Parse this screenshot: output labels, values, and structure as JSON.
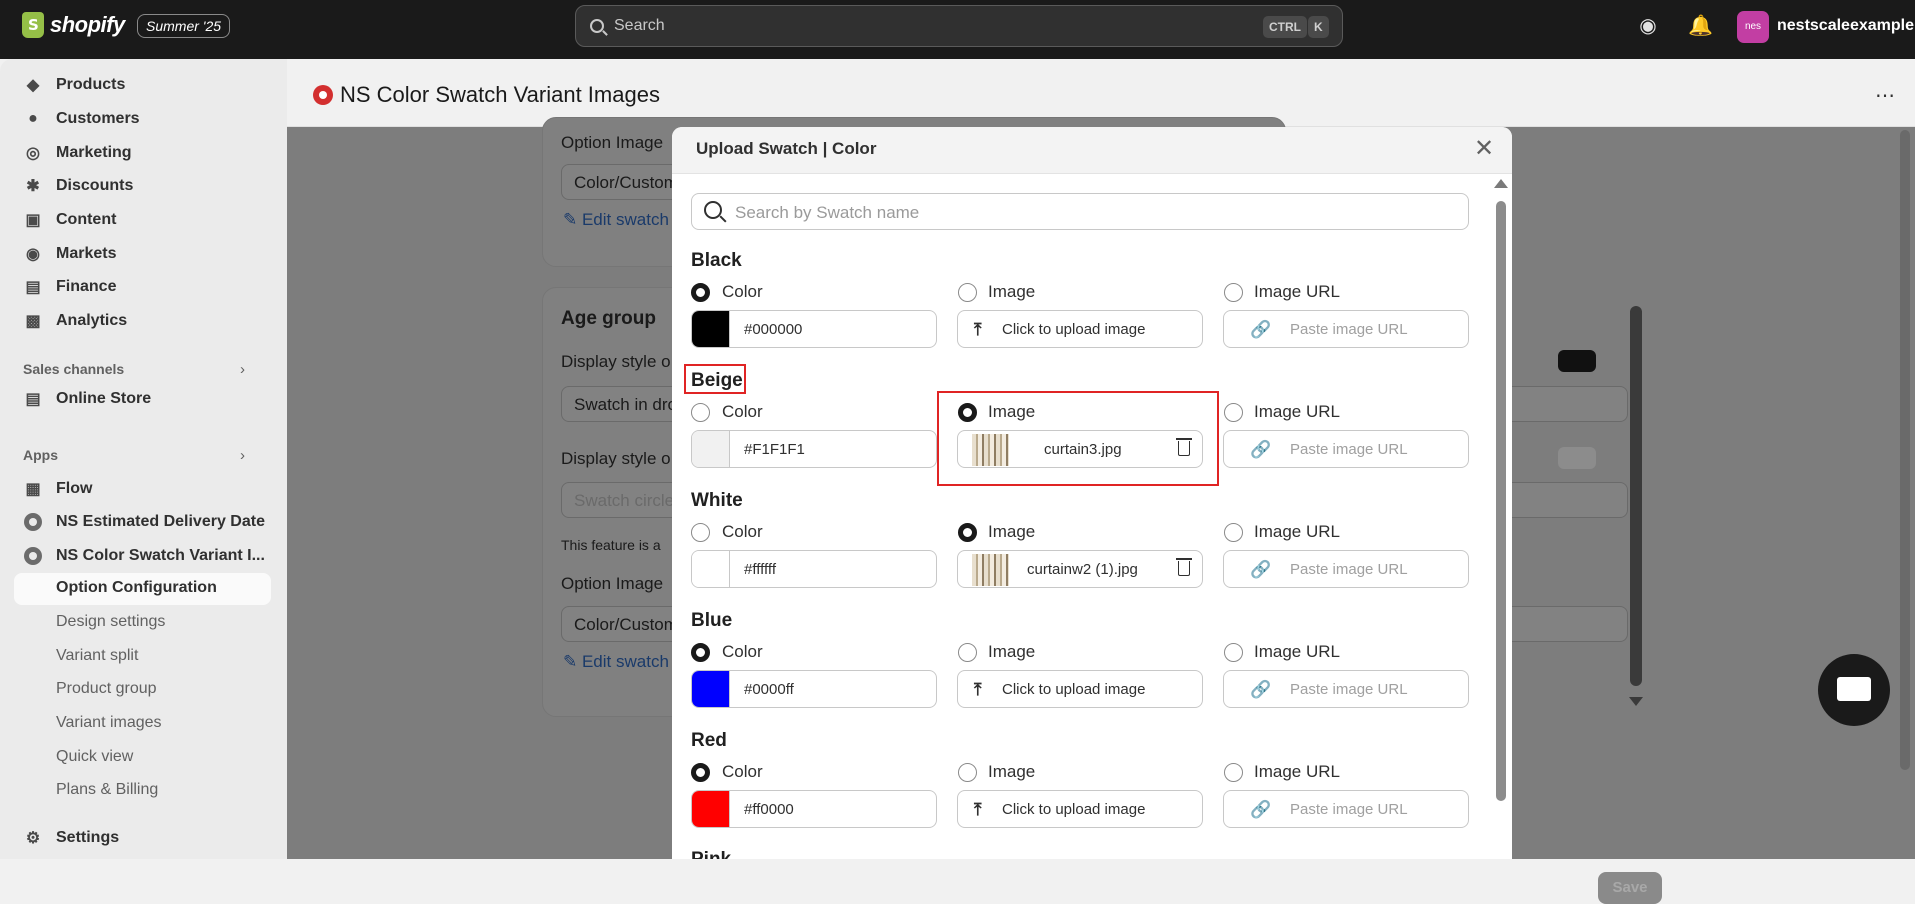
{
  "topbar": {
    "brand": "shopify",
    "edition": "Summer '25",
    "search_placeholder": "Search",
    "kbd_ctrl": "CTRL",
    "kbd_k": "K",
    "avatar_initials": "nes",
    "store_name": "nestscaleexample"
  },
  "sidebar": {
    "items": [
      {
        "label": "Products",
        "icon": "tag-icon"
      },
      {
        "label": "Customers",
        "icon": "person-icon"
      },
      {
        "label": "Marketing",
        "icon": "target-icon"
      },
      {
        "label": "Discounts",
        "icon": "discount-icon"
      },
      {
        "label": "Content",
        "icon": "content-icon"
      },
      {
        "label": "Markets",
        "icon": "globe-icon"
      },
      {
        "label": "Finance",
        "icon": "bank-icon"
      },
      {
        "label": "Analytics",
        "icon": "chart-icon"
      }
    ],
    "sales_channels_label": "Sales channels",
    "online_store": "Online Store",
    "apps_label": "Apps",
    "apps": [
      {
        "label": "Flow"
      },
      {
        "label": "NS Estimated Delivery Date"
      },
      {
        "label": "NS Color Swatch Variant I..."
      }
    ],
    "subitems": [
      "Option Configuration",
      "Design settings",
      "Variant split",
      "Product group",
      "Variant images",
      "Quick view",
      "Plans & Billing"
    ],
    "settings": "Settings"
  },
  "main": {
    "app_title": "NS Color Swatch Variant Images",
    "bg": {
      "option_image_label": "Option Image",
      "color_custom": "Color/Custom",
      "edit_swatch": "Edit swatch",
      "age_group": "Age group",
      "display_style": "Display style o",
      "swatch_in_dropdown": "Swatch in dro",
      "display_style_2": "Display style o",
      "swatch_circle": "Swatch circle",
      "feature_note": "This feature is a",
      "option_image_label_2": "Option Image",
      "color_custom_2": "Color/Custom",
      "edit_swatch_2": "Edit swatch"
    },
    "save": "Save"
  },
  "modal": {
    "title": "Upload Swatch | Color",
    "search_placeholder": "Search by Swatch name",
    "labels": {
      "color": "Color",
      "image": "Image",
      "image_url": "Image URL",
      "upload": "Click to upload image",
      "url_placeholder": "Paste image URL"
    },
    "swatches": [
      {
        "name": "Black",
        "hex": "#000000",
        "chip": "#000000",
        "selected": "color",
        "file": ""
      },
      {
        "name": "Beige",
        "hex": "#F1F1F1",
        "chip": "#f1f1f1",
        "selected": "image",
        "file": "curtain3.jpg"
      },
      {
        "name": "White",
        "hex": "#ffffff",
        "chip": "#ffffff",
        "selected": "image",
        "file": "curtainw2 (1).jpg"
      },
      {
        "name": "Blue",
        "hex": "#0000ff",
        "chip": "#0000ff",
        "selected": "color",
        "file": ""
      },
      {
        "name": "Red",
        "hex": "#ff0000",
        "chip": "#ff0000",
        "selected": "color",
        "file": ""
      },
      {
        "name": "Pink"
      }
    ]
  }
}
